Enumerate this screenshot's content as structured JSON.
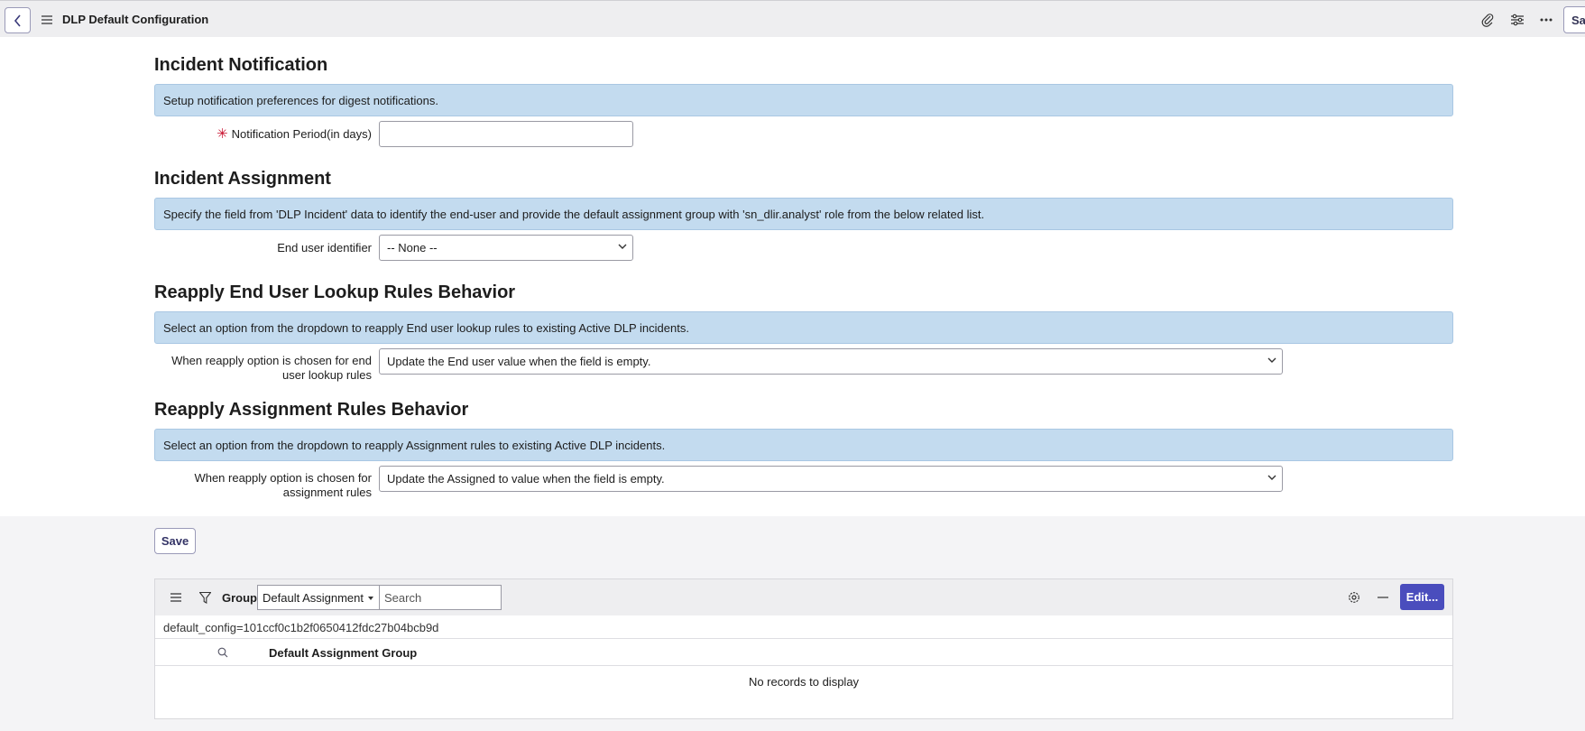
{
  "header": {
    "title": "DLP Default Configuration",
    "save_label": "Sav",
    "icons": [
      "chevron-left-icon",
      "hamburger-icon",
      "paperclip-icon",
      "sliders-icon",
      "more-icon"
    ]
  },
  "sections": {
    "incident_notification": {
      "title": "Incident Notification",
      "info": "Setup notification preferences for digest notifications.",
      "field_label": "Notification Period(in days)",
      "field_value": "",
      "required": true
    },
    "incident_assignment": {
      "title": "Incident Assignment",
      "info": "Specify the field from 'DLP Incident' data to identify the end-user and provide the default assignment group with 'sn_dlir.analyst' role from the below related list.",
      "field_label": "End user identifier",
      "field_value": "-- None --"
    },
    "reapply_lookup": {
      "title": "Reapply End User Lookup Rules Behavior",
      "info": "Select an option from the dropdown to reapply End user lookup rules to existing Active DLP incidents.",
      "field_label": "When reapply option is chosen for end user lookup rules",
      "field_value": "Update the End user value when the field is empty."
    },
    "reapply_assignment": {
      "title": "Reapply Assignment Rules Behavior",
      "info": "Select an option from the dropdown to reapply Assignment rules to existing Active DLP incidents.",
      "field_label": "When reapply option is chosen for assign­ment rules",
      "field_value": "Update the Assigned to value when the field is empty."
    }
  },
  "save_button": "Save",
  "related_list": {
    "group_label": "Group",
    "group_select": "Default Assignment",
    "search_placeholder": "Search",
    "edit_label": "Edit...",
    "filter_text": "default_config=101ccf0c1b2f0650412fdc27b04bcb9d",
    "column_header": "Default Assignment Group",
    "empty_text": "No records to display"
  },
  "colors": {
    "info_bg": "#c3dbef",
    "accent": "#4a4dbd",
    "required": "#c8102e"
  }
}
